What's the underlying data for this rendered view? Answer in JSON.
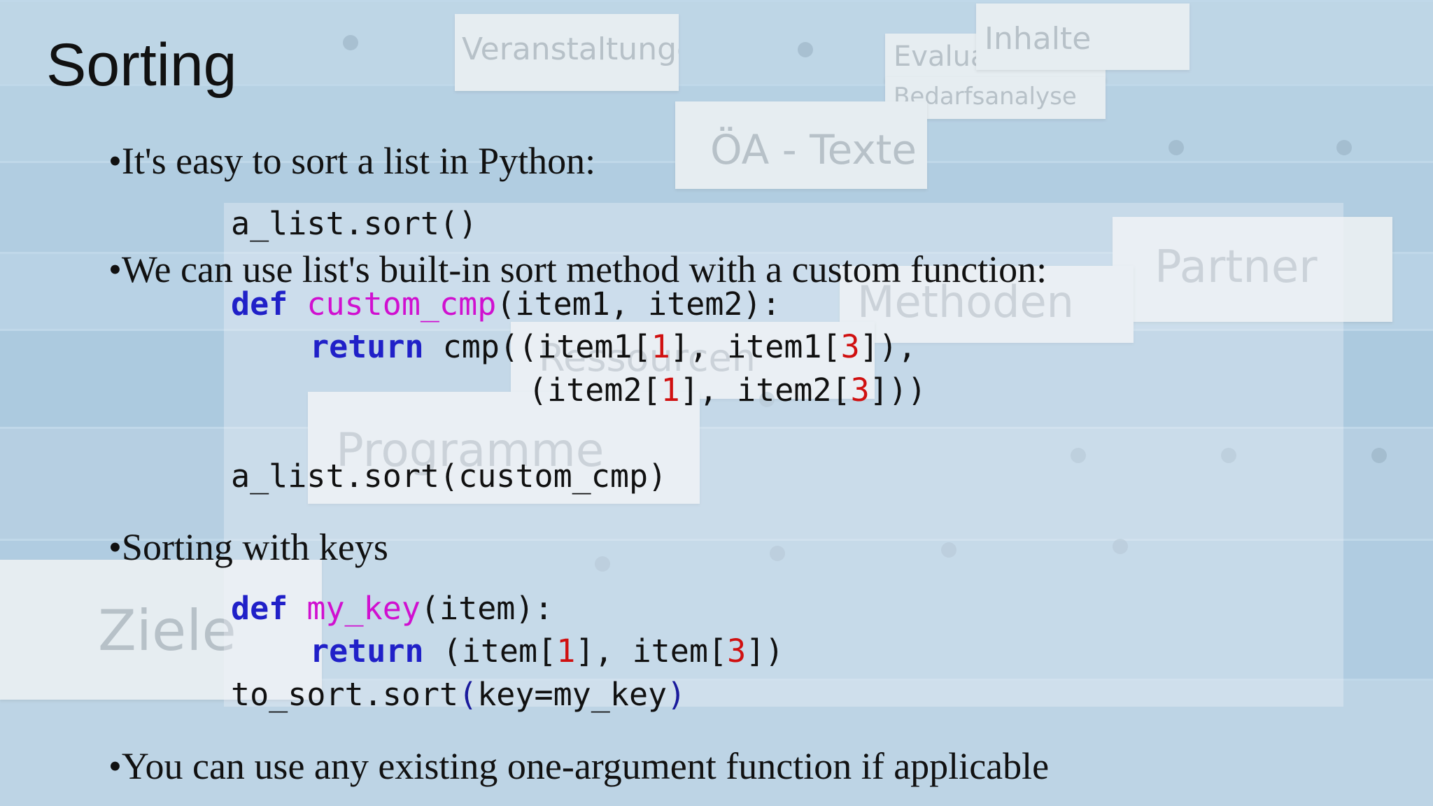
{
  "slide": {
    "title": "Sorting",
    "bullets": [
      "•It's easy to sort a list in Python:",
      "•We can use list's built-in sort method with a custom function:",
      "•Sorting with keys",
      "•You can use any existing one-argument function if applicable"
    ],
    "code": {
      "sort_call": "a_list.sort()",
      "custom": {
        "def": "def",
        "fname": "custom_cmp",
        "params": "(item1, item2):",
        "ret": "return",
        "cmp": "cmp",
        "l1_a": "((item1[",
        "n1": "1",
        "l1_b": "], item1[",
        "n2": "3",
        "l1_c": "]),",
        "l2_a": "(item2[",
        "n3": "1",
        "l2_b": "], item2[",
        "n4": "3",
        "l2_c": "]))",
        "call": "a_list.sort(custom_cmp)"
      },
      "key": {
        "def": "def",
        "fname": "my_key",
        "params": "(item):",
        "ret": "return",
        "r_a": "(item[",
        "n1": "1",
        "r_b": "], item[",
        "n2": "3",
        "r_c": "])",
        "call_a": "to_sort.sort",
        "call_b": "(",
        "call_c": "key=my_key",
        "call_d": ")"
      }
    },
    "background_labels": [
      "Veranstaltungen",
      "Evaluation +",
      "Bedarfsanalyse",
      "Inhalte",
      "ÖA - Texte",
      "Partner",
      "Methoden",
      "Ressourcen",
      "Programme",
      "Ziele"
    ],
    "colors": {
      "keyword": "#2020c8",
      "function": "#d010d0",
      "number": "#d01010"
    }
  }
}
